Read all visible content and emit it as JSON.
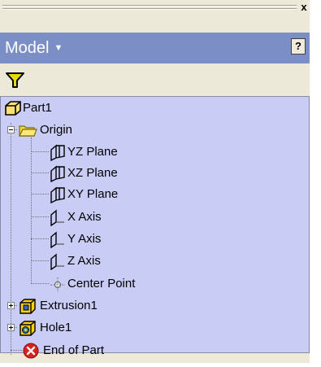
{
  "panel": {
    "title": "Model",
    "title_caret": "▼",
    "close_glyph": "x",
    "help_glyph": "?",
    "filter_icon": "funnel-icon",
    "colors": {
      "header_bg": "#7b8ec5",
      "tree_bg": "#c9cdf5",
      "panel_bg": "#ece9d8",
      "filter": "#e8d800",
      "error": "#d8221c"
    }
  },
  "tree": {
    "root": {
      "label": "Part1",
      "icon": "part-icon"
    },
    "origin": {
      "label": "Origin",
      "icon": "folder-icon",
      "expanded": true,
      "children": [
        {
          "label": "YZ Plane",
          "icon": "plane-icon"
        },
        {
          "label": "XZ Plane",
          "icon": "plane-icon"
        },
        {
          "label": "XY Plane",
          "icon": "plane-icon"
        },
        {
          "label": "X Axis",
          "icon": "axis-icon"
        },
        {
          "label": "Y Axis",
          "icon": "axis-icon"
        },
        {
          "label": "Z Axis",
          "icon": "axis-icon"
        },
        {
          "label": "Center Point",
          "icon": "point-icon"
        }
      ]
    },
    "features": [
      {
        "label": "Extrusion1",
        "icon": "extrusion-icon",
        "expanded": false
      },
      {
        "label": "Hole1",
        "icon": "hole-icon",
        "expanded": false
      }
    ],
    "end": {
      "label": "End of Part",
      "icon": "end-of-part-icon"
    }
  }
}
